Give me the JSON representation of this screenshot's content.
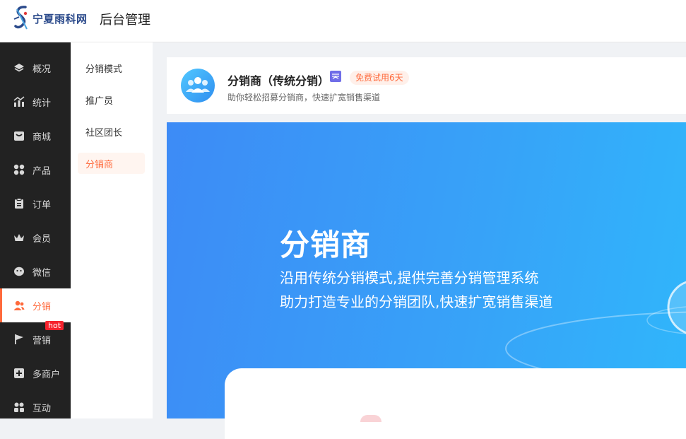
{
  "header": {
    "logo_text": "宁夏雨科网",
    "app_title": "后台管理"
  },
  "sidebar": {
    "items": [
      {
        "label": "概况",
        "icon": "layers-icon"
      },
      {
        "label": "统计",
        "icon": "chart-icon"
      },
      {
        "label": "商城",
        "icon": "shop-icon"
      },
      {
        "label": "产品",
        "icon": "grid-icon"
      },
      {
        "label": "订单",
        "icon": "clipboard-icon"
      },
      {
        "label": "会员",
        "icon": "crown-icon"
      },
      {
        "label": "微信",
        "icon": "wechat-icon"
      },
      {
        "label": "分销",
        "icon": "users-icon",
        "active": true
      },
      {
        "label": "营销",
        "icon": "flag-icon",
        "badge": "hot"
      },
      {
        "label": "多商户",
        "icon": "add-shop-icon"
      },
      {
        "label": "互动",
        "icon": "interact-icon"
      }
    ]
  },
  "subnav": {
    "items": [
      {
        "label": "分销模式"
      },
      {
        "label": "推广员"
      },
      {
        "label": "社区团长"
      },
      {
        "label": "分销商",
        "active": true
      }
    ]
  },
  "plugin_card": {
    "title": "分销商（传统分销）",
    "trial_badge": "免费试用6天",
    "subtitle": "助你轻松招募分销商，快速扩宽销售渠道"
  },
  "banner": {
    "title": "分销商",
    "line1": "沿用传统分销模式,提供完善分销管理系统",
    "line2": "助力打造专业的分销团队,快速扩宽销售渠道"
  },
  "colors": {
    "accent": "#ff6a3c",
    "sidebar_bg": "#222222",
    "banner_start": "#3d8bf6",
    "banner_end": "#30b6fb",
    "hot_badge": "#f5222d"
  }
}
